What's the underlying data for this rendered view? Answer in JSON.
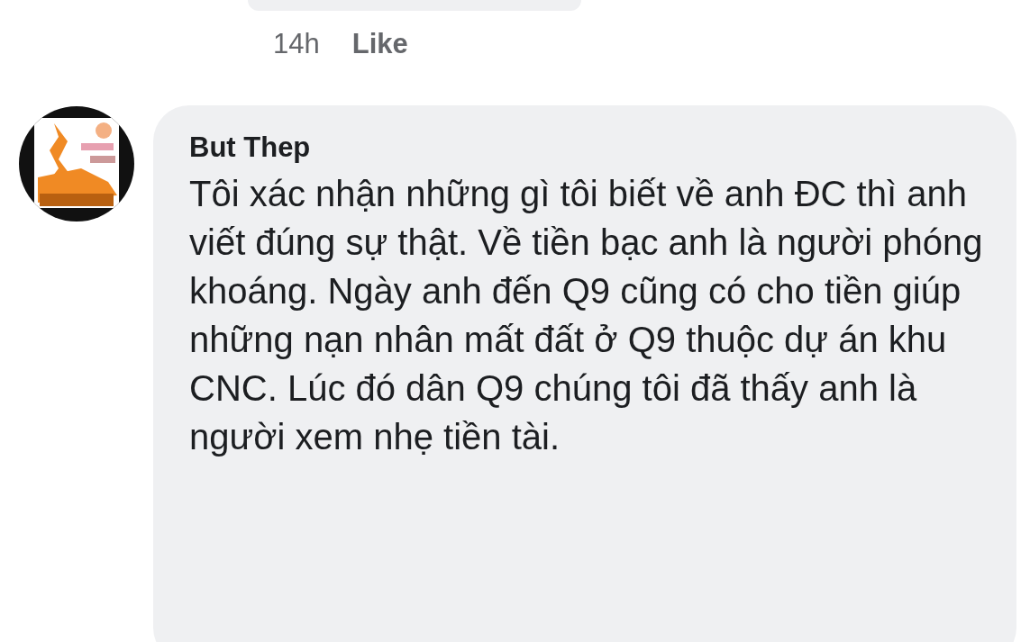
{
  "previous_comment": {
    "time": "14h",
    "action": "Like"
  },
  "comment": {
    "author": "But Thep",
    "text": "Tôi xác nhận những gì tôi biết về anh ĐC thì anh viết đúng sự thật. Về tiền bạc anh là người phóng khoáng. Ngày anh đến Q9 cũng có cho tiền giúp những nạn nhân mất đất ở Q9 thuộc dự án khu CNC. Lúc đó dân Q9 chúng tôi đã thấy anh là người xem nhẹ tiền tài."
  }
}
